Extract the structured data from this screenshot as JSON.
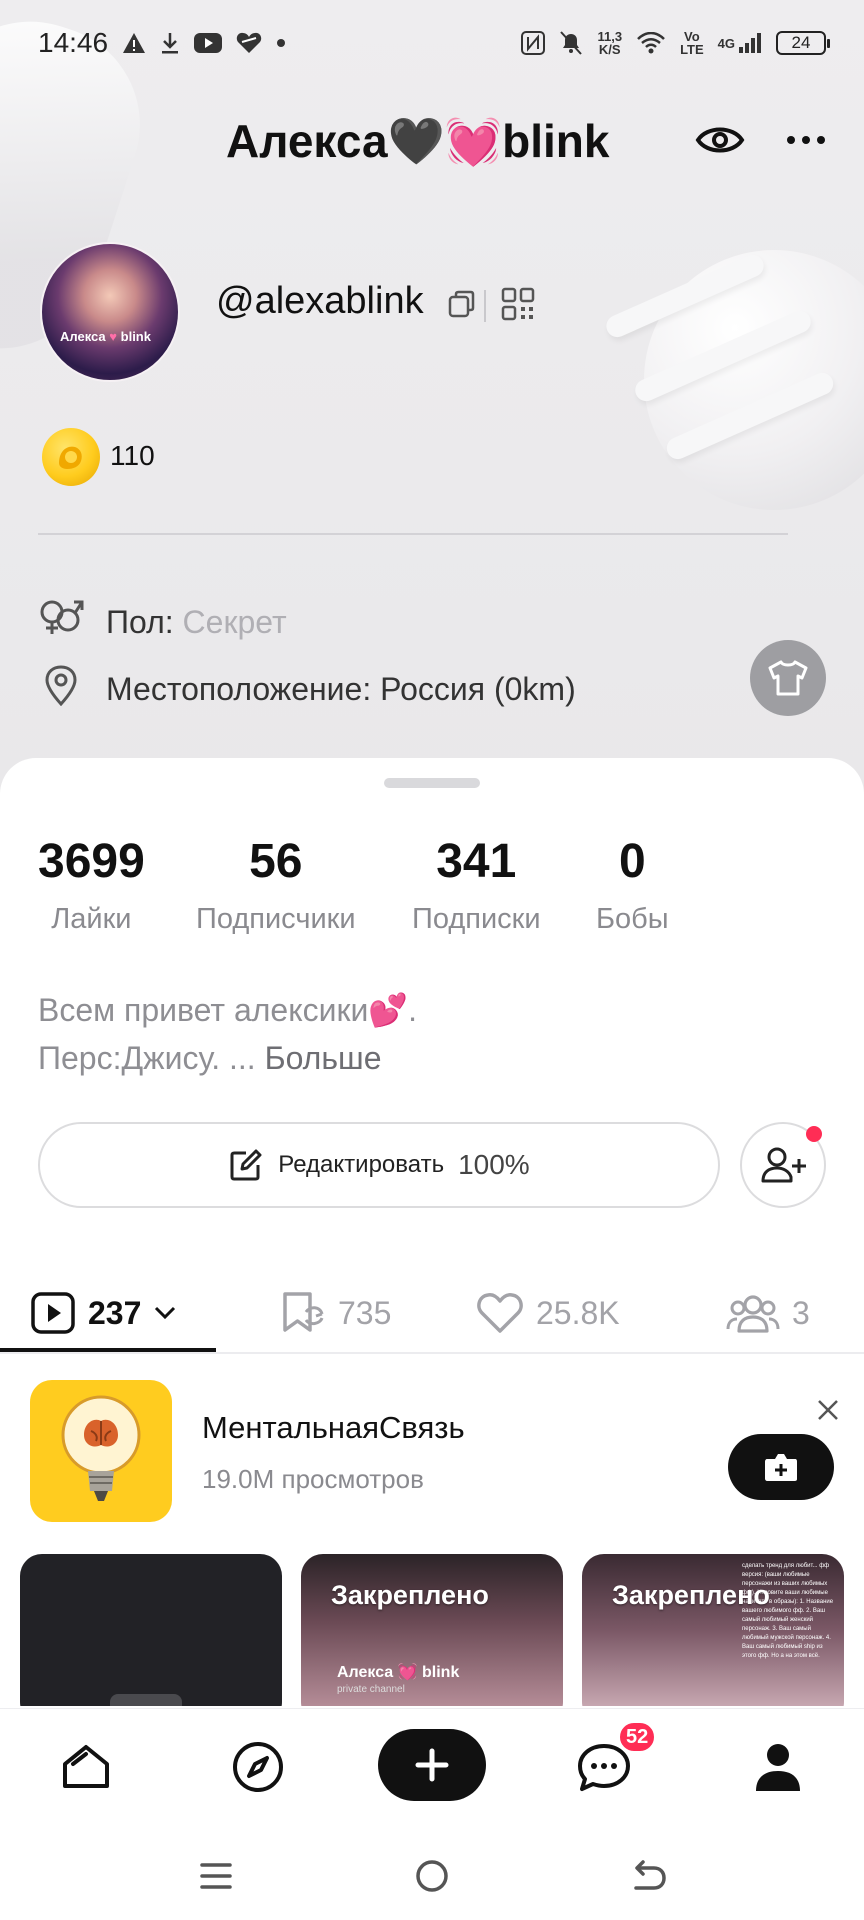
{
  "status_bar": {
    "time": "14:46",
    "net_speed": "11,3",
    "net_unit": "K/S",
    "volte_top": "Vo",
    "volte_bottom": "LTE",
    "signal": "4G",
    "battery": "24"
  },
  "header": {
    "title_left": "Алекса",
    "title_hearts": [
      "🖤",
      "💓"
    ],
    "title_right": "blink"
  },
  "profile": {
    "avatar_caption_left": "Алекса",
    "avatar_caption_right": "blink",
    "username": "@alexablink",
    "coins": "110",
    "gender_label": "Пол:",
    "gender_value": "Секрет",
    "location_label": "Местоположение: Россия (0km)"
  },
  "stats": [
    {
      "value": "3699",
      "label": "Лайки"
    },
    {
      "value": "56",
      "label": "Подписчики"
    },
    {
      "value": "341",
      "label": "Подписки"
    },
    {
      "value": "0",
      "label": "Бобы"
    }
  ],
  "bio": {
    "line1": "Всем привет алексики💕.",
    "line2_prefix": "Перс:Джису. ... ",
    "more": "Больше"
  },
  "edit": {
    "label": "Редактировать",
    "percent": "100%"
  },
  "tabs": [
    {
      "count": "237"
    },
    {
      "count": "735"
    },
    {
      "count": "25.8K"
    },
    {
      "count": "3"
    }
  ],
  "promo": {
    "title": "МентальнаяСвязь",
    "subtitle": "19.0M просмотров"
  },
  "thumbnails": [
    {
      "pinned": ""
    },
    {
      "pinned": "Закреплено",
      "watermark": "Алекса 💓 blink",
      "sub": "private channel"
    },
    {
      "pinned": "Закреплено",
      "text_lines": "сделать тренд для любит... фф версия: (ваши любимые персонажи из ваших любимых фф). Назовите ваши любимые написать в образы): 1. Название вашего любимого фф. 2. Ваш самый любимый женский персонаж. 3. Ваш самый любимый мужской персонаж. 4. Ваш самый любимый ship из этого фф. Но а на этом всё."
    }
  ],
  "bottom_nav": {
    "messages_badge": "52"
  },
  "colors": {
    "accent_pink": "#ff2d55",
    "promo_yellow": "#ffcc1f",
    "heart_pink": "#ff5f9e"
  }
}
